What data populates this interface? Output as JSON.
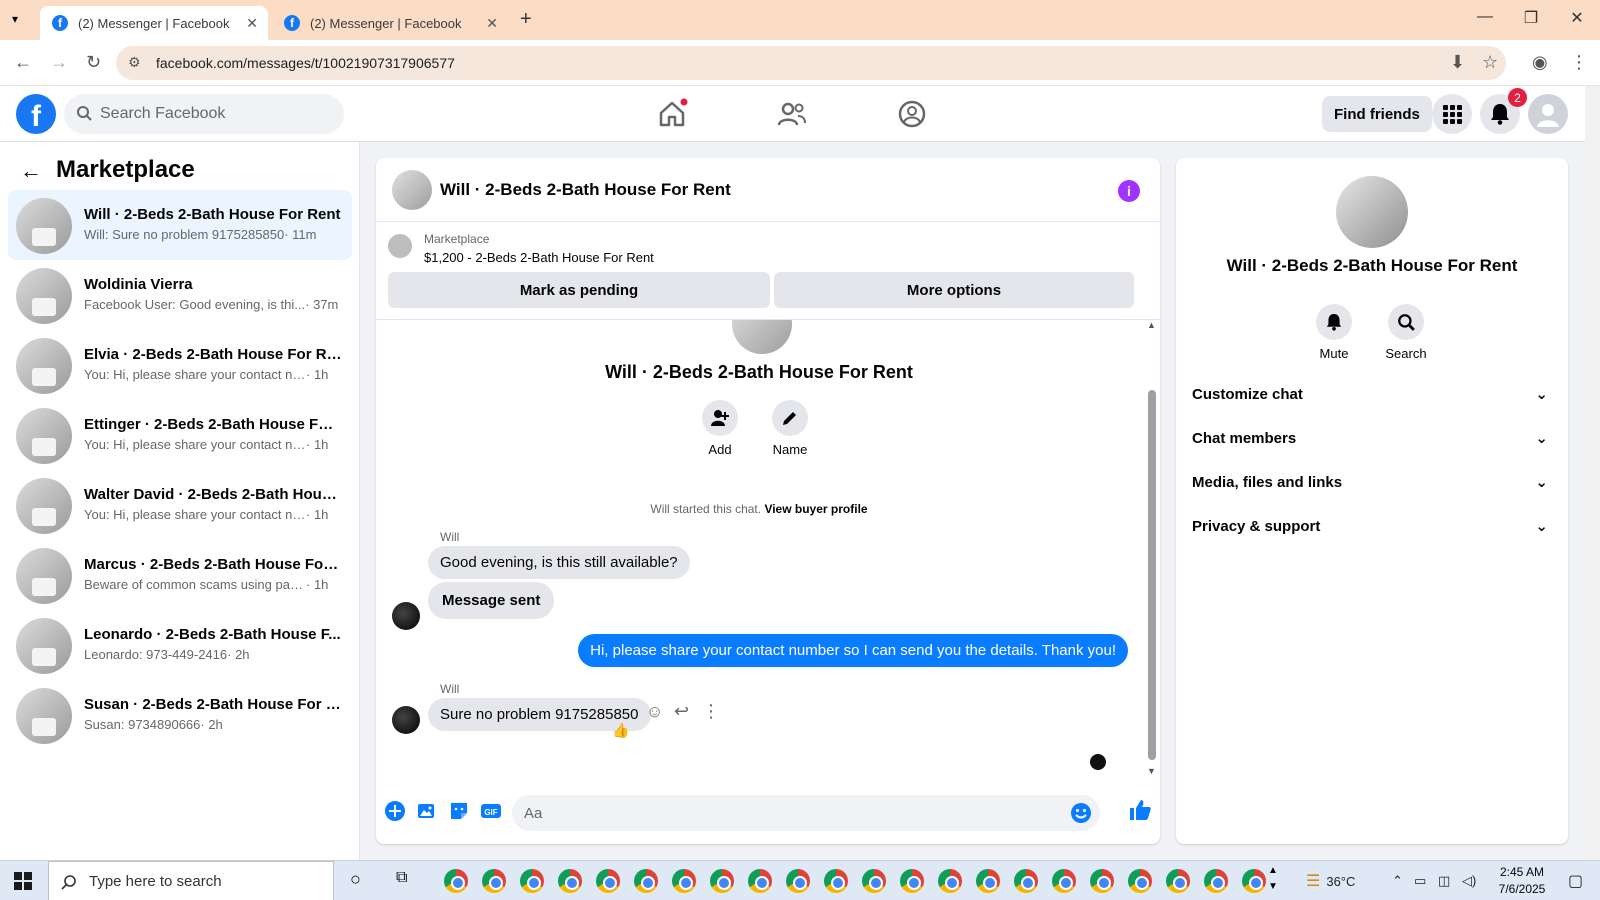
{
  "browser": {
    "tabs": [
      {
        "title": "(2) Messenger | Facebook",
        "active": true
      },
      {
        "title": "(2) Messenger | Facebook",
        "active": false
      }
    ],
    "url": "facebook.com/messages/t/10021907317906577"
  },
  "fb": {
    "search_placeholder": "Search Facebook",
    "find_friends": "Find friends",
    "notification_count": "2"
  },
  "sidebar": {
    "title": "Marketplace",
    "conversations": [
      {
        "name": "Will · 2-Beds 2-Bath House For Rent",
        "preview": "Will: Sure no problem 9175285850",
        "time": "· 11m",
        "active": true
      },
      {
        "name": "Woldinia Vierra",
        "preview": "Facebook User: Good evening, is thi...",
        "time": "· 37m"
      },
      {
        "name": "Elvia · 2-Beds 2-Bath House For Rent",
        "preview": "You: Hi, please share your contact nu...",
        "time": "· 1h"
      },
      {
        "name": "Ettinger · 2-Beds 2-Bath House For...",
        "preview": "You: Hi, please share your contact nu...",
        "time": "· 1h"
      },
      {
        "name": "Walter David · 2-Beds 2-Bath Hous...",
        "preview": "You: Hi, please share your contact nu...",
        "time": "· 1h"
      },
      {
        "name": "Marcus · 2-Beds 2-Bath House For ...",
        "preview": "Beware of common scams using pay...",
        "time": "· 1h"
      },
      {
        "name": "Leonardo · 2-Beds 2-Bath House F...",
        "preview": "Leonardo: 973-449-2416",
        "time": "· 2h"
      },
      {
        "name": "Susan · 2-Beds 2-Bath House For R...",
        "preview": "Susan: 9734890666",
        "time": "· 2h"
      }
    ]
  },
  "chat": {
    "title": "Will · 2-Beds 2-Bath House For Rent",
    "marketplace_label": "Marketplace",
    "listing": "$1,200 - 2-Beds 2-Bath House For Rent",
    "mark_pending": "Mark as pending",
    "more_options": "More options",
    "profile_name": "Will · 2-Beds 2-Bath House For Rent",
    "add_label": "Add",
    "name_label": "Name",
    "started_text": "Will started this chat.",
    "view_buyer": "View buyer profile",
    "messages": {
      "sender1": "Will",
      "m1": "Good evening, is this still available?",
      "m2": "Message sent",
      "m3": "Hi, please share your contact number so I can send you the details. Thank you!",
      "sender2": "Will",
      "m4": "Sure no problem 9175285850",
      "reaction": "👍"
    },
    "composer_placeholder": "Aa"
  },
  "info": {
    "name": "Will · 2-Beds 2-Bath House For Rent",
    "mute": "Mute",
    "search": "Search",
    "sections": [
      "Customize chat",
      "Chat members",
      "Media, files and links",
      "Privacy & support"
    ]
  },
  "taskbar": {
    "search_placeholder": "Type here to search",
    "temperature": "36°C",
    "time": "2:45 AM",
    "date": "7/6/2025"
  },
  "colors": {
    "fb_blue": "#1877f2",
    "outgoing_bubble": "#0a7cff",
    "info_purple": "#a033ff",
    "active_conv": "#ebf5ff"
  }
}
